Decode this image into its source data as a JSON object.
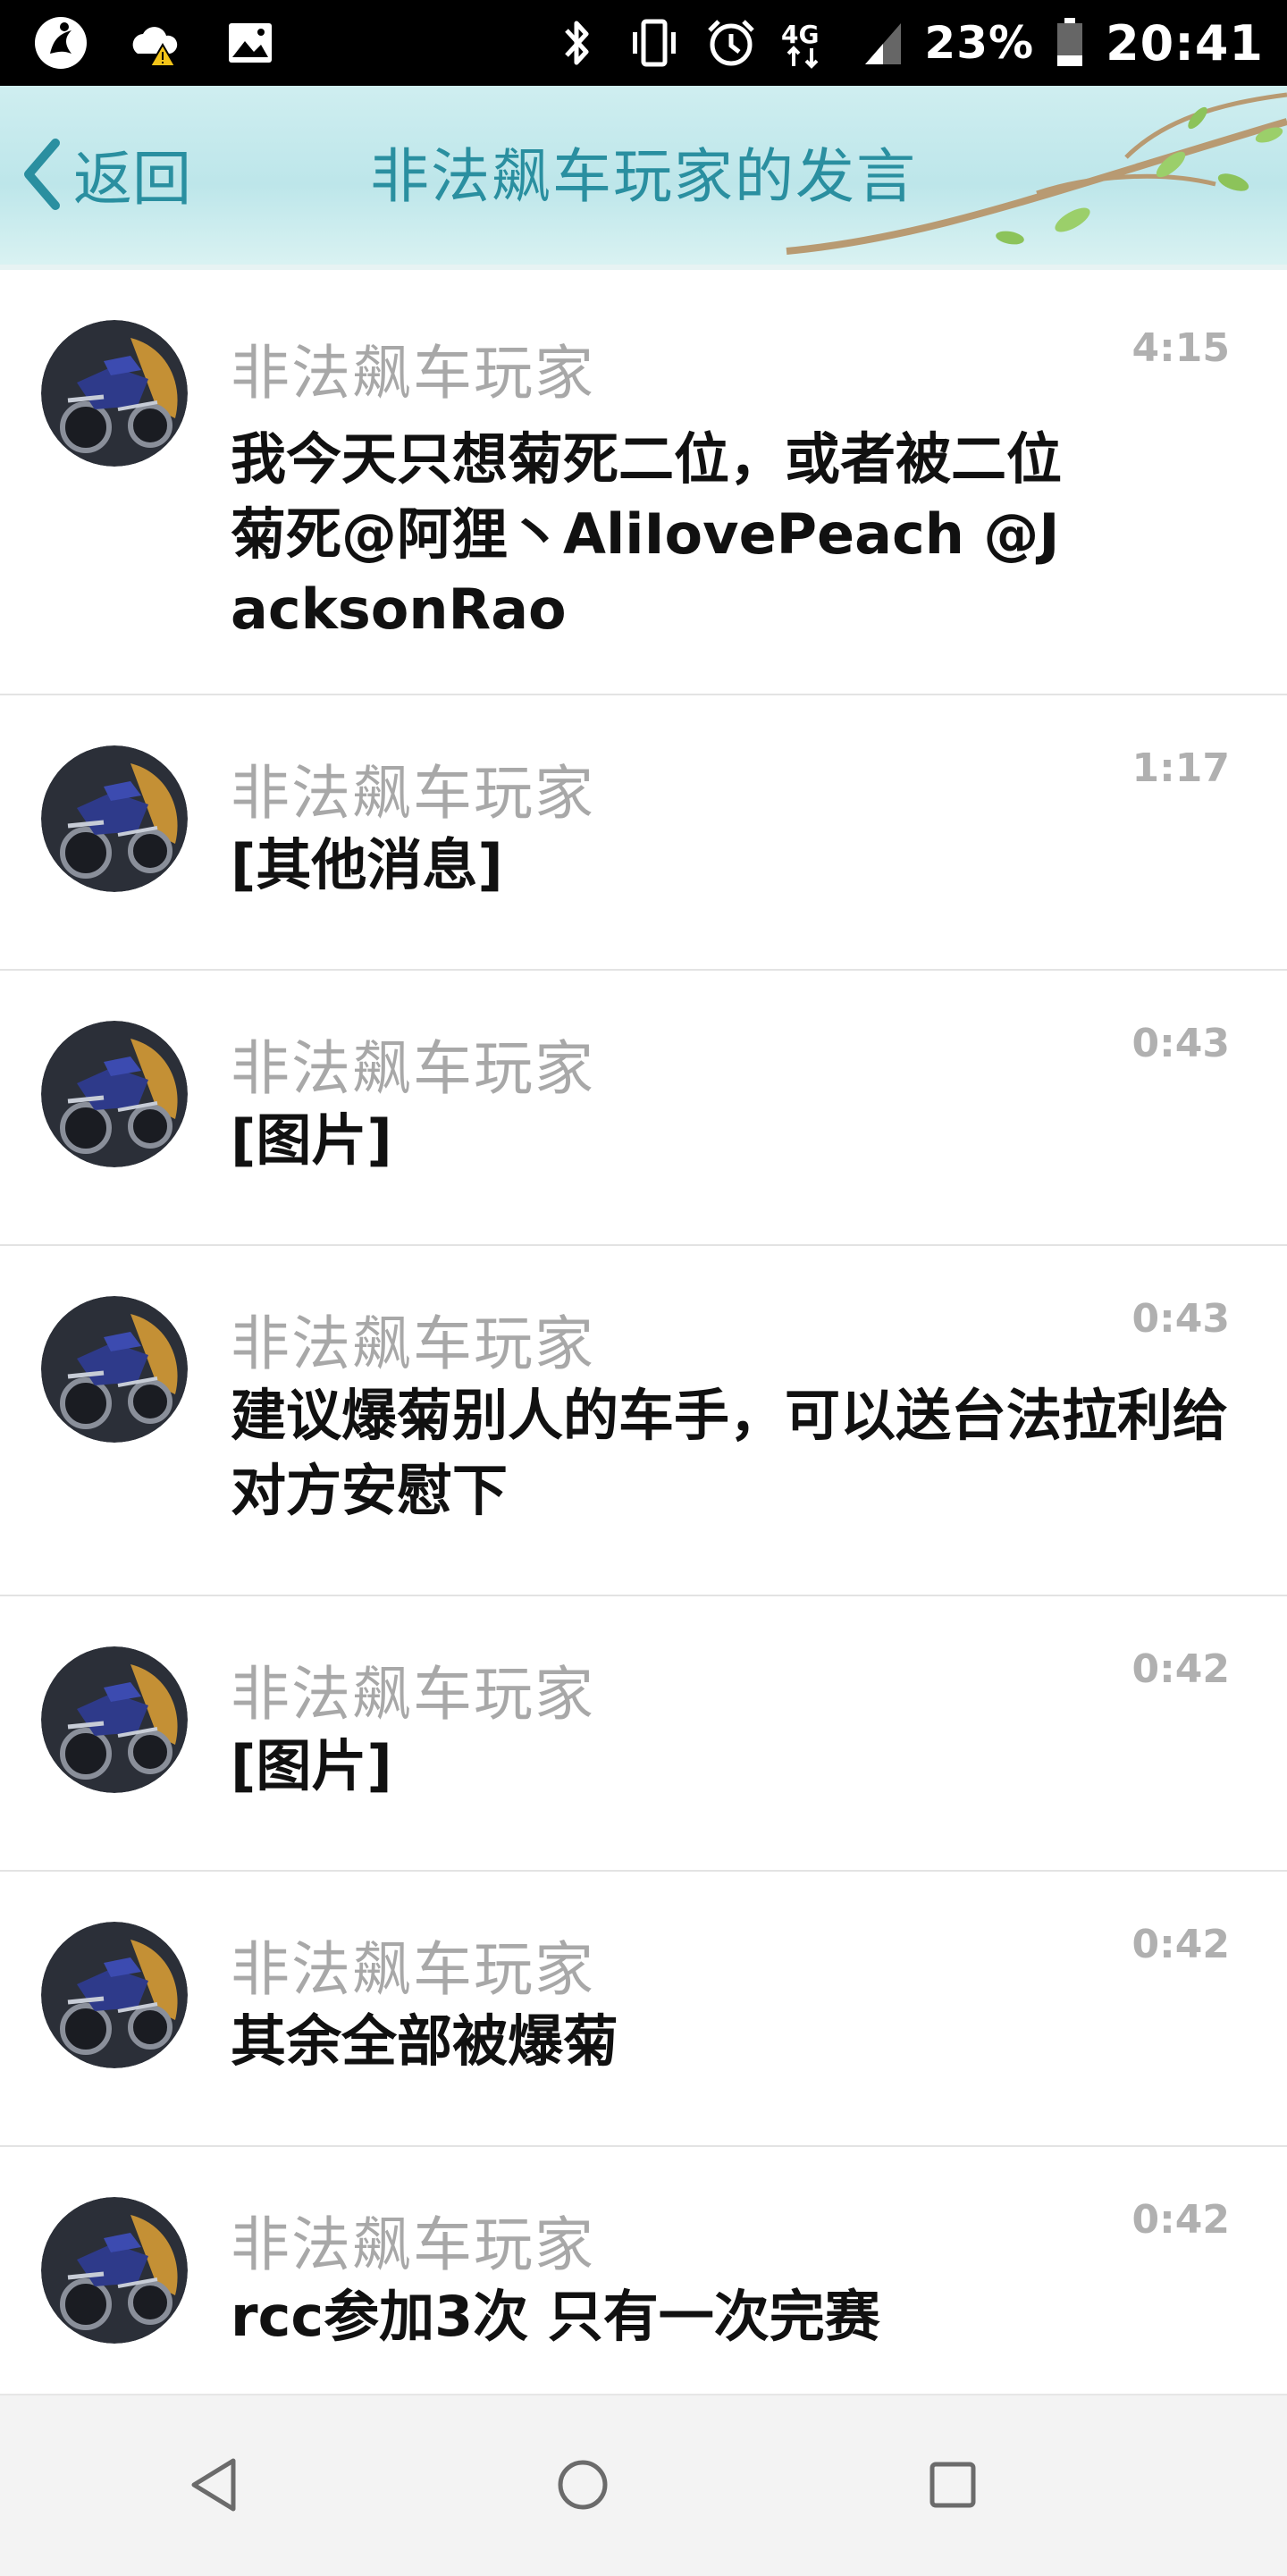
{
  "status_bar": {
    "battery": "23%",
    "time": "20:41",
    "network": "4G",
    "icons": [
      "messenger-icon",
      "weather-icon",
      "gallery-icon",
      "bluetooth-icon",
      "vibrate-icon",
      "alarm-icon",
      "network-icon",
      "signal-icon",
      "battery-icon"
    ]
  },
  "header": {
    "back_label": "返回",
    "title": "非法飙车玩家的发言"
  },
  "messages": [
    {
      "name": "非法飙车玩家",
      "time": "4:15",
      "text": "我今天只想菊死二位，或者被二位菊死@阿狸丶AliIovePeach @JacksonRao"
    },
    {
      "name": "非法飙车玩家",
      "time": "1:17",
      "text": "[其他消息]"
    },
    {
      "name": "非法飙车玩家",
      "time": "0:43",
      "text": "[图片]"
    },
    {
      "name": "非法飙车玩家",
      "time": "0:43",
      "text": "建议爆菊别人的车手，可以送台法拉利给对方安慰下"
    },
    {
      "name": "非法飙车玩家",
      "time": "0:42",
      "text": "[图片]"
    },
    {
      "name": "非法飙车玩家",
      "time": "0:42",
      "text": "其余全部被爆菊"
    },
    {
      "name": "非法飙车玩家",
      "time": "0:42",
      "text": "rcc参加3次 只有一次完赛"
    }
  ],
  "colors": {
    "accent": "#2a8fa0",
    "name_gray": "#a8a8a8",
    "divider": "#e3e3e3"
  },
  "nav": {
    "icons": [
      "back-triangle-icon",
      "home-circle-icon",
      "recents-square-icon"
    ]
  }
}
